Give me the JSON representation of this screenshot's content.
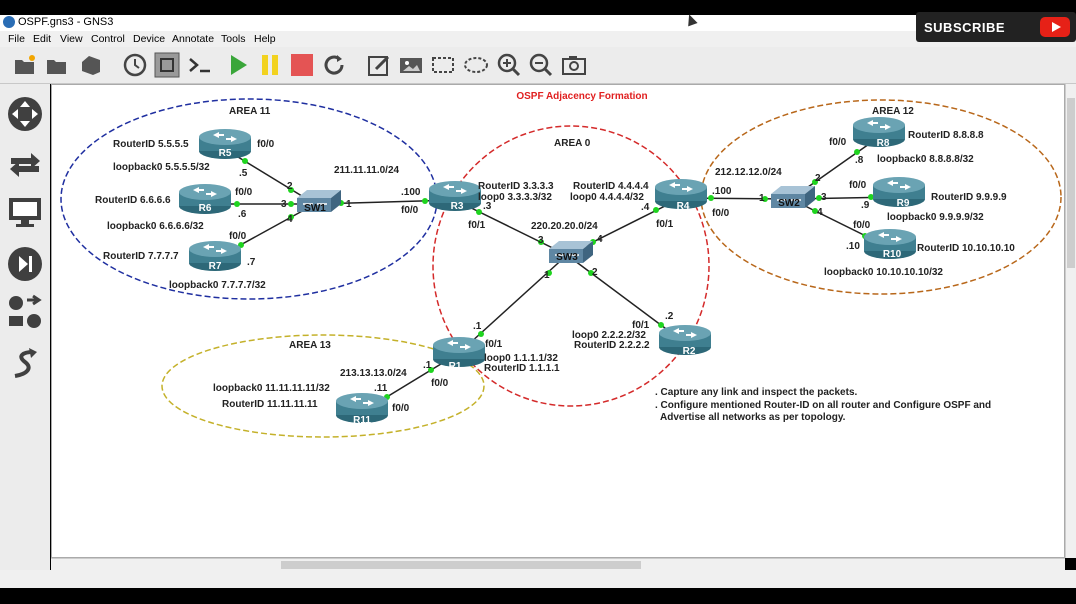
{
  "window": {
    "title": "OSPF.gns3 - GNS3"
  },
  "menu": [
    "File",
    "Edit",
    "View",
    "Control",
    "Device",
    "Annotate",
    "Tools",
    "Help"
  ],
  "toolbar_icons": [
    "open-folder-icon",
    "open-project-icon",
    "save-icon",
    "clock-icon",
    "grid-snap-icon",
    "console-icon",
    "start-icon",
    "pause-icon",
    "stop-icon",
    "reload-icon",
    "note-icon",
    "picture-icon",
    "rectangle-icon",
    "ellipse-icon",
    "zoom-in-icon",
    "zoom-out-icon",
    "camera-icon"
  ],
  "sidebar_icons": [
    "browse-routers-icon",
    "browse-switches-icon",
    "browse-end-devices-icon",
    "browse-security-icon",
    "browse-all-icon",
    "add-link-icon"
  ],
  "subscribe": {
    "label": "SUBSCRIBE"
  },
  "colors": {
    "area11": "#1f2fa0",
    "area0": "#d42a2a",
    "area12": "#b8671a",
    "area13": "#c4b12a",
    "title": "#e02020",
    "router": "#3f7f90",
    "switch": "#6f95ad",
    "port": "#1fd41f"
  },
  "topology": {
    "title": "OSPF Adjacency Formation",
    "areas": [
      "AREA 11",
      "AREA 0",
      "AREA 12",
      "AREA 13"
    ],
    "routers": [
      "R5",
      "R6",
      "R7",
      "R3",
      "R4",
      "R8",
      "R9",
      "R10",
      "R1",
      "R2",
      "R11"
    ],
    "switches": [
      "SW1",
      "SW3",
      "SW2"
    ],
    "labels": {
      "r5_id": "RouterID 5.5.5.5",
      "r5_lo": "loopback0 5.5.5.5/32",
      "r6_id": "RouterID 6.6.6.6",
      "r6_lo": "loopback0 6.6.6.6/32",
      "r7_id": "RouterID 7.7.7.7",
      "r7_lo": "loopback0 7.7.7.7/32",
      "r3_id": "RouterID 3.3.3.3",
      "r3_lo": "loop0 3.3.3.3/32",
      "r4_id": "RouterID 4.4.4.4",
      "r4_lo": "loop0 4.4.4.4/32",
      "r8_id": "RouterID 8.8.8.8",
      "r8_lo": "loopback0 8.8.8.8/32",
      "r9_id": "RouterID 9.9.9.9",
      "r9_lo": "loopback0 9.9.9.9/32",
      "r10_id": "RouterID 10.10.10.10",
      "r10_lo": "loopback0 10.10.10.10/32",
      "r1_lo": "loop0 1.1.1.1/32",
      "r1_id": "RouterID 1.1.1.1",
      "r2_lo": "loop0 2.2.2.2/32",
      "r2_id": "RouterID 2.2.2.2",
      "r11_lo": "loopback0 11.11.11.11/32",
      "r11_id": "RouterID 11.11.11.11",
      "net_11": "211.11.11.0/24",
      "net_0": "220.20.20.0/24",
      "net_12": "212.12.12.0/24",
      "net_13": "213.13.13.0/24",
      "f00": "f0/0",
      "f01": "f0/1",
      "ip5": ".5",
      "ip6": ".6",
      "ip7": ".7",
      "ip100": ".100",
      "ip3": ".3",
      "ip4": ".4",
      "ip8": ".8",
      "ip9": ".9",
      "ip10": ".10",
      "ip1": ".1",
      "ip2": ".2",
      "ip11": ".11",
      "p1": "1",
      "p2": "2",
      "p3": "3",
      "p4": "4"
    },
    "notes": [
      ". Capture any link and inspect the packets.",
      ". Configure mentioned Router-ID on all router and Configure OSPF and",
      "Advertise all networks as per topology."
    ]
  }
}
